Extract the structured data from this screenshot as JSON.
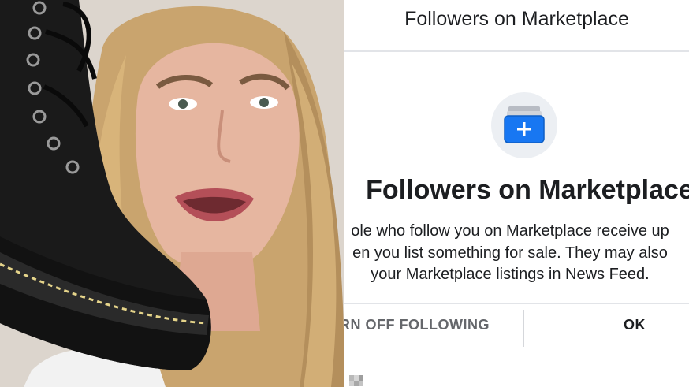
{
  "panel": {
    "title": "Followers on Marketplace",
    "heading": "Followers on Marketplace",
    "description_lines": [
      "ole who follow you on Marketplace receive up",
      "en you list something for sale. They may also",
      "your Marketplace listings in News Feed."
    ],
    "buttons": {
      "turn_off": "RN OFF FOLLOWING",
      "ok": "OK"
    },
    "icon": "marketplace-folder-add-icon",
    "accent_color": "#1877f2"
  },
  "photo": {
    "subject": "woman-holding-boot"
  }
}
